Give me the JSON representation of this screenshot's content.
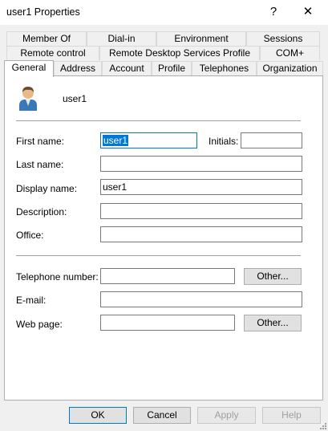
{
  "window": {
    "title": "user1 Properties",
    "help_glyph": "?",
    "close_glyph": "✕"
  },
  "tabs": {
    "row1": [
      "Member Of",
      "Dial-in",
      "Environment",
      "Sessions"
    ],
    "row2": [
      "Remote control",
      "Remote Desktop Services Profile",
      "COM+"
    ],
    "row3": [
      "General",
      "Address",
      "Account",
      "Profile",
      "Telephones",
      "Organization"
    ],
    "active": "General"
  },
  "general": {
    "user_name": "user1",
    "fields": {
      "first_name": {
        "label": "First name:",
        "value": "user1"
      },
      "initials": {
        "label": "Initials:",
        "value": ""
      },
      "last_name": {
        "label": "Last name:",
        "value": ""
      },
      "display_name": {
        "label": "Display name:",
        "value": "user1"
      },
      "description": {
        "label": "Description:",
        "value": ""
      },
      "office": {
        "label": "Office:",
        "value": ""
      },
      "telephone": {
        "label": "Telephone number:",
        "value": ""
      },
      "email": {
        "label": "E-mail:",
        "value": ""
      },
      "web_page": {
        "label": "Web page:",
        "value": ""
      }
    },
    "other_label": "Other..."
  },
  "buttons": {
    "ok": "OK",
    "cancel": "Cancel",
    "apply": "Apply",
    "help": "Help"
  },
  "colors": {
    "accent": "#0078d7",
    "panel_bg": "#ffffff",
    "dialog_bg": "#f0f0f0"
  }
}
